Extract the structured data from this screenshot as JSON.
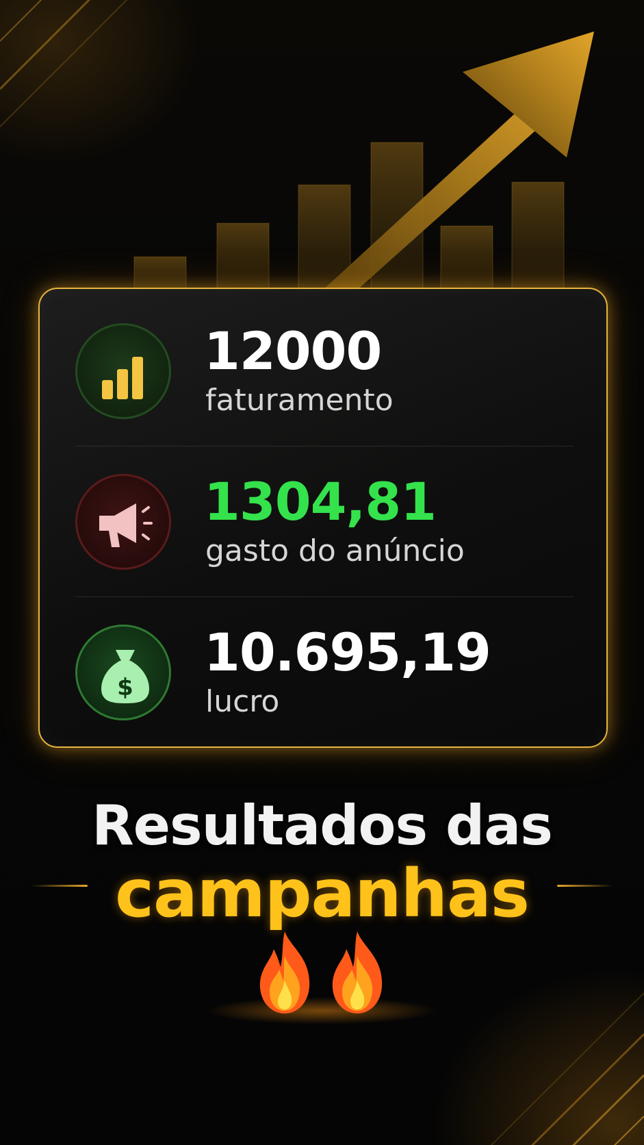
{
  "stats": [
    {
      "value": "12000",
      "label": "faturamento",
      "icon": "bar-chart-icon",
      "value_color": "#ffffff",
      "icon_color": "#f4c542"
    },
    {
      "value": "1304,81",
      "label": "gasto do anúncio",
      "icon": "megaphone-icon",
      "value_color": "#34e24c",
      "icon_color": "#f2c2c2"
    },
    {
      "value": "10.695,19",
      "label": "lucro",
      "icon": "money-bag-icon",
      "value_color": "#ffffff",
      "icon_color": "#a8efb0"
    }
  ],
  "headline": {
    "line1": "Resultados das",
    "line2": "campanhas",
    "emoji": "🔥🔥"
  },
  "theme": {
    "accent": "#ffc21a",
    "card_border": "#e8b53e",
    "background": "#050505"
  }
}
